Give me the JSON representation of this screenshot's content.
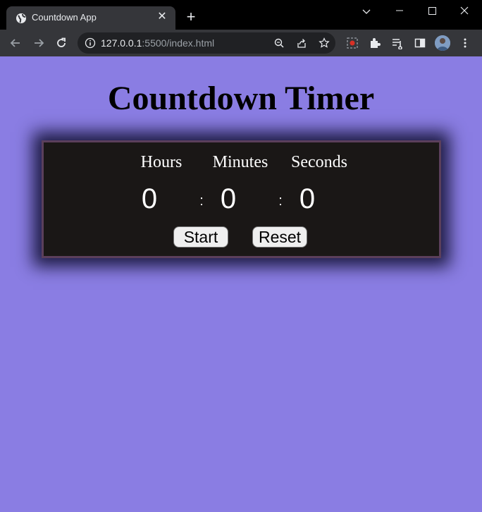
{
  "browser": {
    "tab_title": "Countdown App",
    "url_host": "127.0.0.1",
    "url_rest": ":5500/index.html"
  },
  "page": {
    "title": "Countdown Timer",
    "labels": {
      "hours": "Hours",
      "minutes": "Minutes",
      "seconds": "Seconds"
    },
    "values": {
      "hours": "0",
      "minutes": "0",
      "seconds": "0"
    },
    "separator": ":",
    "buttons": {
      "start": "Start",
      "reset": "Reset"
    }
  },
  "colors": {
    "page_background": "#8a7de3",
    "panel_background": "#1a1716",
    "panel_border": "#5b3f5b"
  }
}
